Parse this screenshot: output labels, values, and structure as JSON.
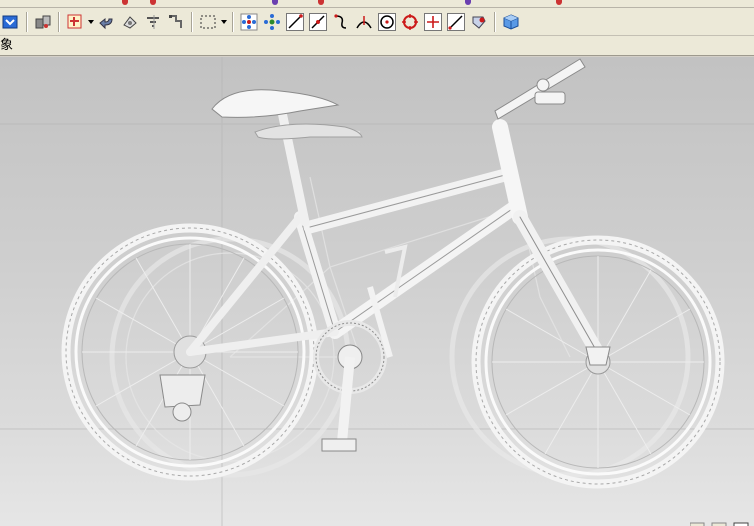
{
  "toolbar": {
    "buttons": [
      "view-dropdown-icon",
      "render-style-icon",
      "snap-point-icon",
      "undo-arrow-icon",
      "view-orient-icon",
      "select-filter-icon",
      "move-handles-icon",
      "selection-box-icon",
      "point-constructor-icon",
      "point-set-icon",
      "line-icon",
      "line-arrow-icon",
      "arc-icon",
      "fillet-icon",
      "circle-icon",
      "circle-target-icon",
      "plus-point-icon",
      "diagonal-line-icon",
      "sphere-icon",
      "cube-icon"
    ]
  },
  "tabbar": {
    "label": "象"
  },
  "colors": {
    "chrome": "#ece9d8",
    "viewport_top": "#c2c2c2",
    "viewport_bottom": "#e6e6e6",
    "accent_red": "#cc1a1a",
    "accent_blue": "#2a6bd6"
  },
  "viewport": {
    "model": "mountain-bike-wireframe"
  }
}
